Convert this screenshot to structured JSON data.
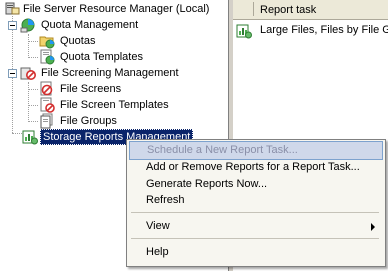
{
  "tree": {
    "root": "File Server Resource Manager (Local)",
    "quota_management": "Quota Management",
    "quotas": "Quotas",
    "quota_templates": "Quota Templates",
    "file_screening_management": "File Screening Management",
    "file_screens": "File Screens",
    "file_screen_templates": "File Screen Templates",
    "file_groups": "File Groups",
    "storage_reports_management": "Storage Reports Management"
  },
  "list": {
    "column_header": "Report task",
    "rows": [
      "Large Files, Files by File Gr"
    ]
  },
  "context_menu": {
    "schedule": "Schedule a New Report Task...",
    "add_remove": "Add or Remove Reports for a Report Task...",
    "generate": "Generate Reports Now...",
    "refresh": "Refresh",
    "view": "View",
    "help": "Help"
  }
}
